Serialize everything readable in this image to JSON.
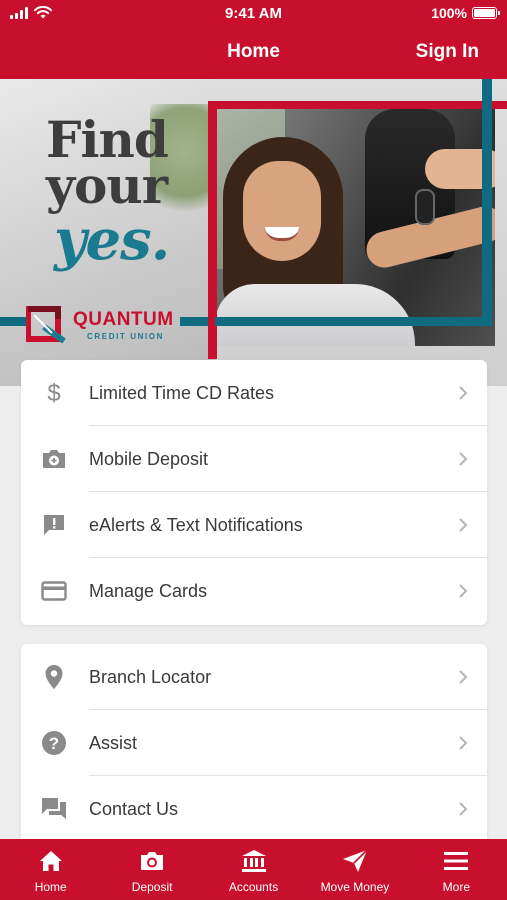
{
  "status_bar": {
    "time": "9:41 AM",
    "battery": "100%"
  },
  "header": {
    "title": "Home",
    "sign_in_label": "Sign In",
    "bg_color": "#c8102e"
  },
  "hero": {
    "headline_line1": "Find",
    "headline_line2": "your",
    "headline_line3": "yes.",
    "brand_name": "QUANTUM",
    "brand_sub": "CREDIT UNION",
    "accent_red": "#c8102e",
    "accent_teal": "#0f6b80"
  },
  "menu_group1": [
    {
      "label": "Limited Time CD Rates",
      "icon": "dollar-icon"
    },
    {
      "label": "Mobile Deposit",
      "icon": "camera-icon"
    },
    {
      "label": "eAlerts & Text Notifications",
      "icon": "alert-message-icon"
    },
    {
      "label": "Manage Cards",
      "icon": "credit-card-icon"
    }
  ],
  "menu_group2": [
    {
      "label": "Branch Locator",
      "icon": "location-pin-icon"
    },
    {
      "label": "Assist",
      "icon": "help-icon"
    },
    {
      "label": "Contact Us",
      "icon": "chat-icon"
    }
  ],
  "tabs": [
    {
      "label": "Home",
      "icon": "home-icon"
    },
    {
      "label": "Deposit",
      "icon": "camera-icon"
    },
    {
      "label": "Accounts",
      "icon": "bank-icon"
    },
    {
      "label": "Move Money",
      "icon": "send-icon"
    },
    {
      "label": "More",
      "icon": "menu-icon"
    }
  ]
}
